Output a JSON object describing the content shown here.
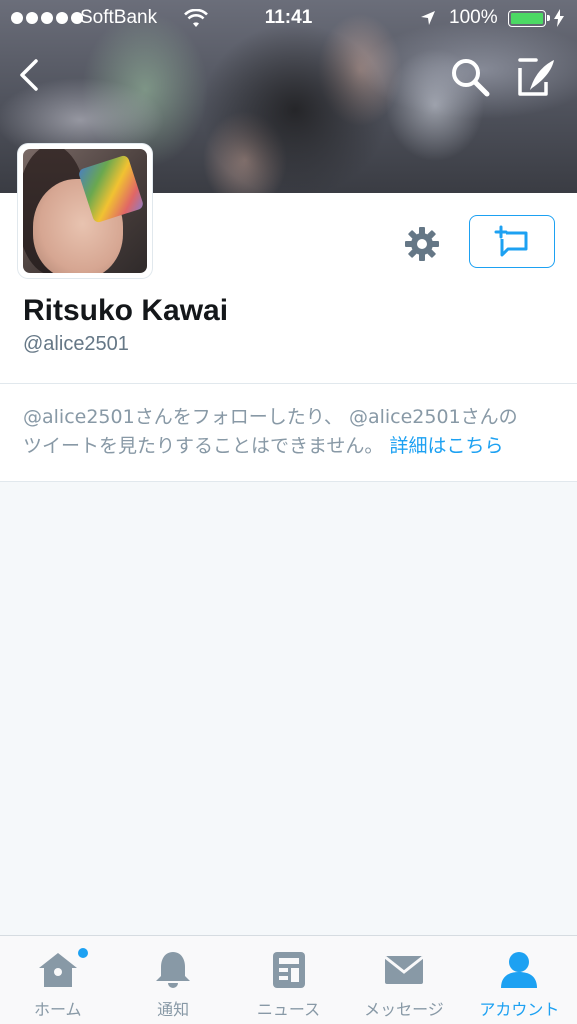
{
  "status_bar": {
    "carrier": "SoftBank",
    "time": "11:41",
    "battery": "100%",
    "battery_level": 1.0
  },
  "header": {
    "back_icon": "chevron-left-icon",
    "search_icon": "search-icon",
    "compose_icon": "compose-icon"
  },
  "profile": {
    "display_name": "Ritsuko Kawai",
    "handle": "@alice2501",
    "settings_icon": "gear-icon",
    "message_icon": "add-message-icon"
  },
  "protected": {
    "line1": "@alice2501さんをフォローしたり、 @alice2501さんの",
    "line2": "ツイートを見たりすることはできません。",
    "learn_more": "詳細はこちら"
  },
  "tab_bar": {
    "tabs": [
      {
        "label": "ホーム",
        "icon": "home-icon",
        "active": false,
        "badge": true
      },
      {
        "label": "通知",
        "icon": "bell-icon",
        "active": false
      },
      {
        "label": "ニュース",
        "icon": "news-icon",
        "active": false
      },
      {
        "label": "メッセージ",
        "icon": "envelope-icon",
        "active": false
      },
      {
        "label": "アカウント",
        "icon": "person-icon",
        "active": true
      }
    ]
  },
  "colors": {
    "accent": "#1da1f2",
    "icon_gray": "#8899a6",
    "background": "#f5f8fa"
  }
}
